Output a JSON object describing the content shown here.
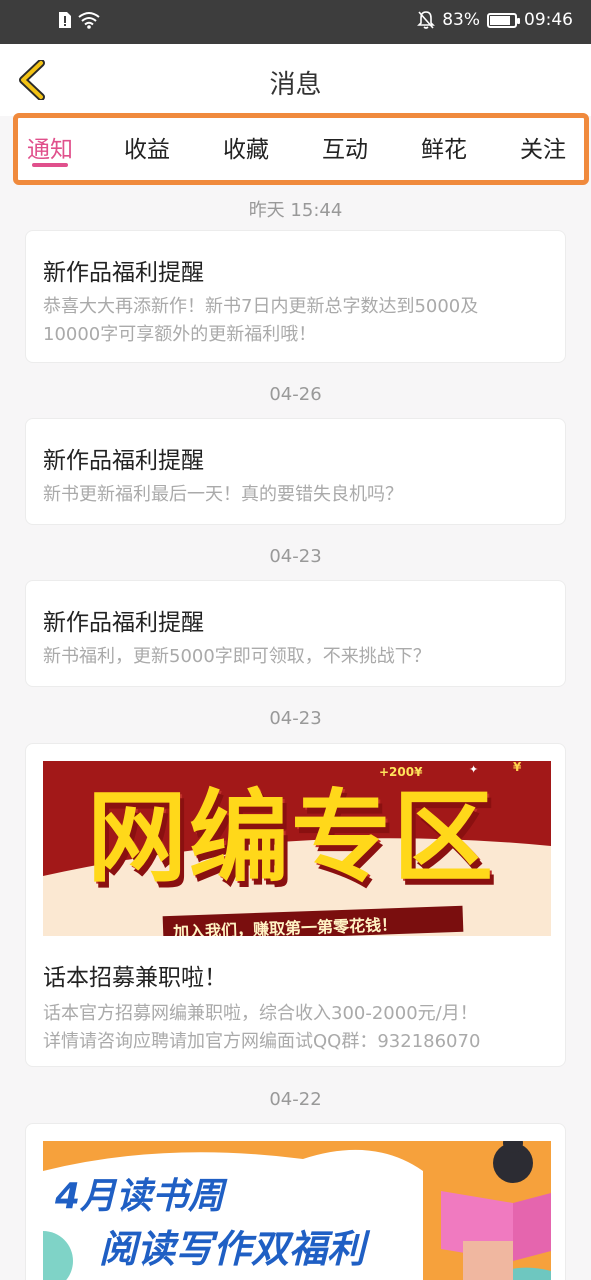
{
  "status_bar": {
    "battery": "83%",
    "time": "09:46",
    "battery_level": 0.83
  },
  "header": {
    "title": "消息"
  },
  "tabs": [
    {
      "label": "通知",
      "active": true
    },
    {
      "label": "收益"
    },
    {
      "label": "收藏"
    },
    {
      "label": "互动"
    },
    {
      "label": "鲜花"
    },
    {
      "label": "关注"
    }
  ],
  "messages": [
    {
      "date": "昨天 15:44",
      "title": "新作品福利提醒",
      "lines": [
        "恭喜大大再添新作！新书7日内更新总字数达到5000及",
        "10000字可享额外的更新福利哦！"
      ]
    },
    {
      "date": "04-26",
      "title": "新作品福利提醒",
      "lines": [
        "新书更新福利最后一天！真的要错失良机吗？"
      ]
    },
    {
      "date": "04-23",
      "title": "新作品福利提醒",
      "lines": [
        "新书福利，更新5000字即可领取，不来挑战下？"
      ]
    },
    {
      "date": "04-23",
      "banner": {
        "headline": "网编专区",
        "tag": "+200¥",
        "strip": "加入我们，赚取第一第零花钱！"
      },
      "title": "话本招募兼职啦！",
      "lines": [
        "话本官方招募网编兼职啦，综合收入300-2000元/月！",
        "详情请咨询应聘请加官方网编面试QQ群：932186070"
      ]
    },
    {
      "date": "04-22",
      "banner": {
        "line1": "4月读书周",
        "line2": "阅读写作双福利"
      }
    }
  ]
}
